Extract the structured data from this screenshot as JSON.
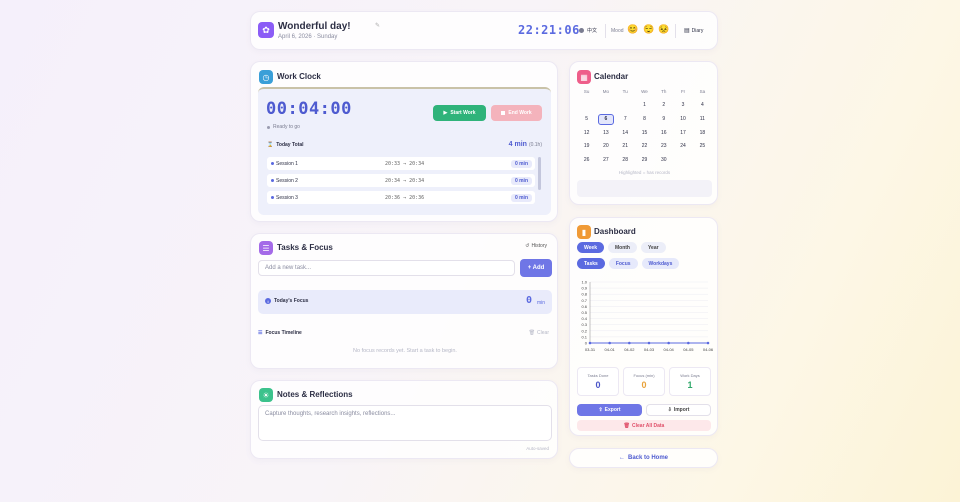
{
  "header": {
    "title": "Wonderful day!",
    "date": "April 6, 2026 · Sunday",
    "clock": "22:21:06",
    "language": "中文",
    "mood_label": "Mood",
    "moods": [
      "😊",
      "😌",
      "😣"
    ],
    "diary_label": "Diary"
  },
  "work_clock": {
    "title": "Work Clock",
    "timer": "00:04:00",
    "status": "Ready to go",
    "start_label": "Start Work",
    "end_label": "End Work",
    "today_total_label": "Today Total",
    "today_total_value": "4 min",
    "today_total_hours": "(0.1h)",
    "sessions": [
      {
        "name": "Session 1",
        "range": "20:33 → 20:34",
        "duration": "0 min"
      },
      {
        "name": "Session 2",
        "range": "20:34 → 20:34",
        "duration": "0 min"
      },
      {
        "name": "Session 3",
        "range": "20:36 → 20:36",
        "duration": "0 min"
      }
    ]
  },
  "tasks": {
    "title": "Tasks & Focus",
    "history_label": "History",
    "input_placeholder": "Add a new task...",
    "add_label": "+ Add",
    "todays_focus_label": "Today's Focus",
    "focus_value": "0",
    "focus_unit": "min",
    "timeline_label": "Focus Timeline",
    "clear_label": "Clear",
    "empty_text": "No focus records yet. Start a task to begin."
  },
  "notes": {
    "title": "Notes & Reflections",
    "placeholder": "Capture thoughts, research insights, reflections...",
    "autosave": "Auto-saved"
  },
  "calendar": {
    "title": "Calendar",
    "weekdays": [
      "Su",
      "Mo",
      "Tu",
      "We",
      "Th",
      "Fr",
      "Sa"
    ],
    "weeks": [
      [
        "",
        "",
        "",
        "1",
        "2",
        "3",
        "4"
      ],
      [
        "5",
        "6",
        "7",
        "8",
        "9",
        "10",
        "11"
      ],
      [
        "12",
        "13",
        "14",
        "15",
        "16",
        "17",
        "18"
      ],
      [
        "19",
        "20",
        "21",
        "22",
        "23",
        "24",
        "25"
      ],
      [
        "26",
        "27",
        "28",
        "29",
        "30",
        "",
        ""
      ]
    ],
    "selected_day": "6",
    "legend": "Highlighted = has records"
  },
  "dashboard": {
    "title": "Dashboard",
    "range_tabs": [
      "Week",
      "Month",
      "Year"
    ],
    "active_range": "Week",
    "metric_tabs": [
      "Tasks",
      "Focus",
      "Workdays"
    ],
    "active_metric": "Tasks",
    "stats": [
      {
        "label": "Tasks Done",
        "value": "0",
        "color": "#4a55c8"
      },
      {
        "label": "Focus (min)",
        "value": "0",
        "color": "#e8a23a"
      },
      {
        "label": "Work Days",
        "value": "1",
        "color": "#2fa86a"
      }
    ],
    "export_label": "Export",
    "import_label": "Import",
    "clear_all_label": "Clear All Data"
  },
  "back_home_label": "Back to Home",
  "chart_data": {
    "type": "line",
    "categories": [
      "03-31",
      "04-01",
      "04-02",
      "04-03",
      "04-04",
      "04-05",
      "04-06"
    ],
    "series": [
      {
        "values": [
          0,
          0,
          0,
          0,
          0,
          0,
          0
        ],
        "color": "#5b6ae0"
      }
    ],
    "y_ticks": [
      "1.0",
      "0.9",
      "0.8",
      "0.7",
      "0.6",
      "0.5",
      "0.4",
      "0.3",
      "0.2",
      "0.1",
      "0"
    ],
    "ylim": [
      0,
      1
    ],
    "grid": true
  }
}
